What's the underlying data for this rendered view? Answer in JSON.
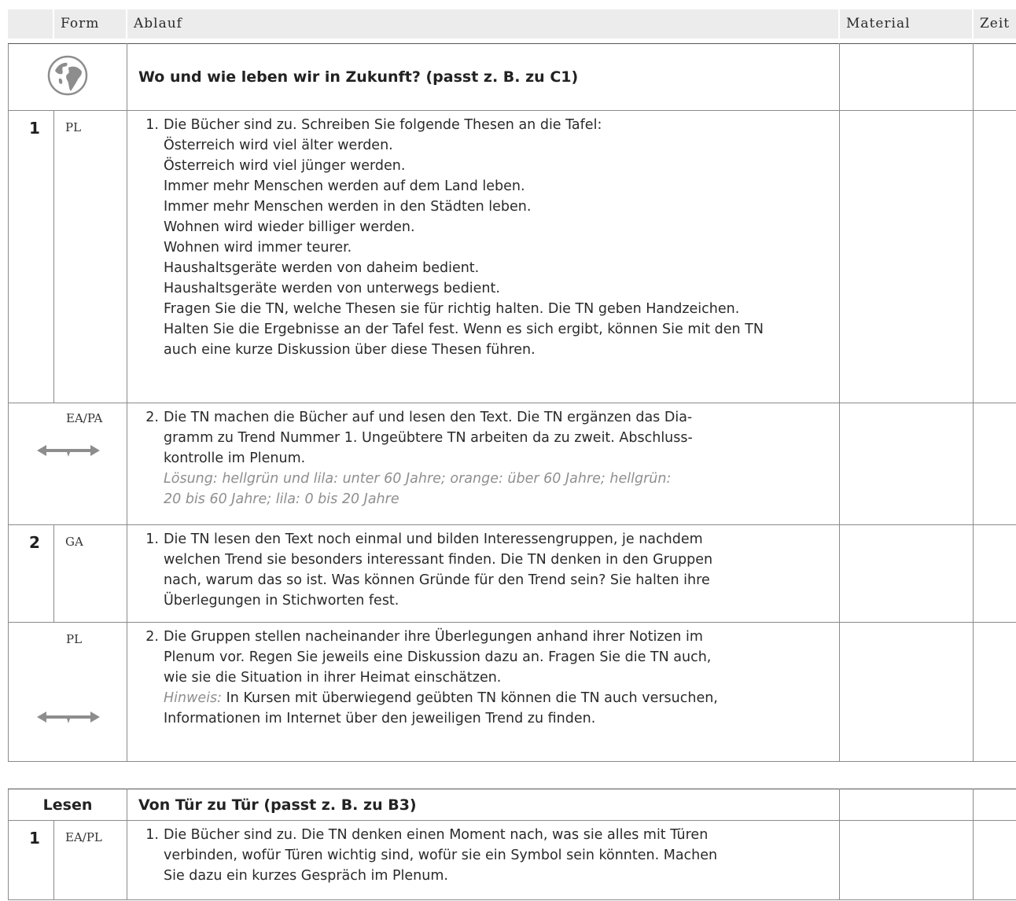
{
  "header": {
    "form": "Form",
    "ablauf": "Ablauf",
    "material": "Material",
    "zeit": "Zeit"
  },
  "section1": {
    "icon": "globe-icon",
    "title": "Wo und wie leben wir in Zukunft? (passt z. B. zu C1)",
    "rows": [
      {
        "number": "1",
        "form": "PL",
        "step": "1.",
        "lines": [
          "Die Bücher sind zu. Schreiben Sie folgende Thesen an die Tafel:",
          "Österreich wird viel älter werden.",
          "Österreich wird viel jünger werden.",
          "Immer mehr Menschen werden auf dem Land leben.",
          "Immer mehr Menschen werden in den Städten leben.",
          "Wohnen wird wieder billiger werden.",
          "Wohnen wird immer teurer.",
          "Haushaltsgeräte werden von daheim bedient.",
          "Haushaltsgeräte werden von unterwegs bedient.",
          "Fragen Sie die TN, welche Thesen sie für richtig halten. Die TN geben Handzeichen.",
          "Halten Sie die Ergebnisse an der Tafel fest. Wenn es sich ergibt, können Sie mit den TN",
          "auch eine kurze Diskussion über diese Thesen führen."
        ]
      },
      {
        "number": "",
        "form": "EA/PA",
        "step": "2.",
        "lines": [
          "Die TN machen die Bücher auf und lesen den Text. Die TN ergänzen das Dia-",
          "gramm zu Trend Nummer 1. Ungeübtere TN arbeiten da zu zweit. Abschluss-",
          "kontrolle im Plenum."
        ],
        "solution": [
          "Lösung: hellgrün und lila: unter 60 Jahre; orange: über 60 Jahre; hellgrün:",
          "20 bis 60 Jahre; lila: 0 bis 20 Jahre"
        ]
      },
      {
        "number": "2",
        "form": "GA",
        "step": "1.",
        "lines": [
          "Die TN lesen den Text noch einmal und bilden Interessengruppen, je nachdem",
          "welchen Trend sie besonders interessant finden. Die TN denken in den Gruppen",
          "nach, warum das so ist. Was können Gründe für den Trend sein? Sie halten ihre",
          "Überlegungen in Stichworten fest."
        ]
      },
      {
        "number": "",
        "form": "PL",
        "step": "2.",
        "lines": [
          "Die Gruppen stellen nacheinander ihre Überlegungen anhand ihrer Notizen im",
          "Plenum vor. Regen Sie jeweils eine Diskussion dazu an. Fragen Sie die TN auch,",
          "wie sie die Situation in ihrer Heimat einschätzen."
        ],
        "hint_label": "Hinweis:",
        "hint_text": " In Kursen mit überwiegend geübten TN können die TN auch versuchen,",
        "hint_line2": "Informationen im Internet über den jeweiligen Trend zu finden."
      }
    ]
  },
  "section2": {
    "label": "Lesen",
    "title": "Von Tür zu Tür (passt z. B. zu B3)",
    "rows": [
      {
        "number": "1",
        "form": "EA/PL",
        "step": "1.",
        "lines": [
          "Die Bücher sind zu. Die TN denken einen Moment nach, was sie alles mit Türen",
          "verbinden, wofür Türen wichtig sind, wofür sie ein Symbol sein könnten. Machen",
          "Sie dazu ein kurzes Gespräch im Plenum."
        ]
      }
    ]
  }
}
